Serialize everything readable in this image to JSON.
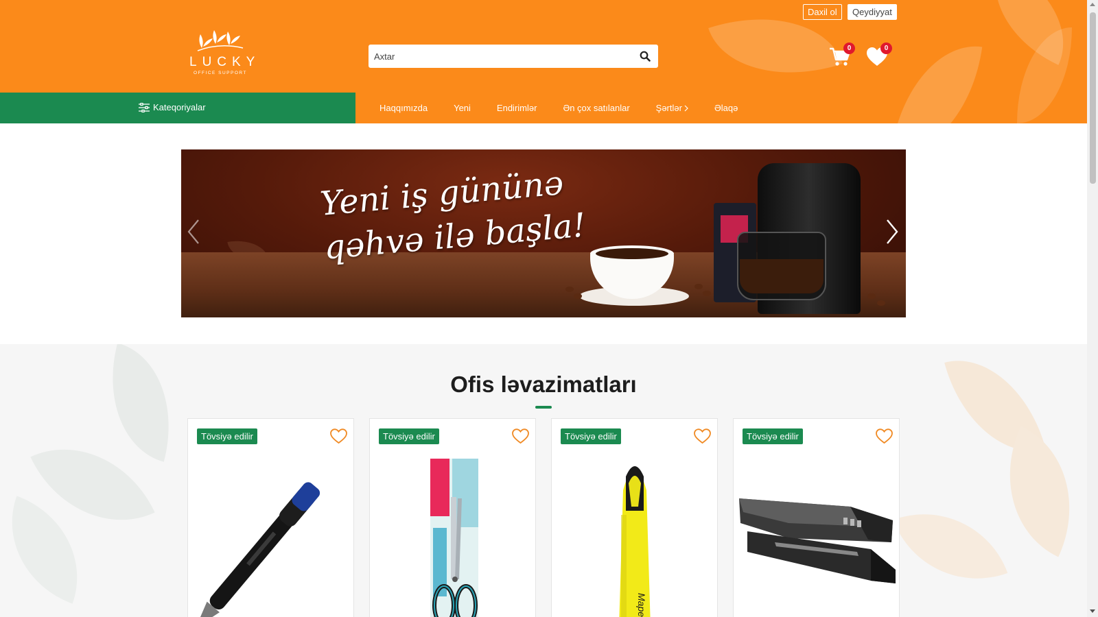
{
  "header": {
    "logo": {
      "name": "LUCKY",
      "subtitle": "OFFICE SUPPORT"
    },
    "search": {
      "placeholder": "Axtar",
      "value": ""
    },
    "auth": {
      "login_label": "Daxil ol",
      "register_label": "Qeydiyyat"
    },
    "cart": {
      "count": "0",
      "icon": "cart-icon"
    },
    "wishlist": {
      "count": "0",
      "icon": "heart-icon"
    },
    "colors": {
      "brand_orange": "#fb8a1a",
      "brand_green": "#1b8a50",
      "badge_red": "#e0182d"
    }
  },
  "nav": {
    "categories_label": "Kateqoriyalar",
    "items": [
      {
        "label": "Haqqımızda"
      },
      {
        "label": "Yeni"
      },
      {
        "label": "Endirimlər"
      },
      {
        "label": "Ən çox satılanlar"
      },
      {
        "label": "Şərtlər",
        "has_submenu": true
      },
      {
        "label": "Əlaqə"
      }
    ]
  },
  "banner": {
    "line1": "Yeni iş gününə",
    "line2": "qəhvə ilə başla!"
  },
  "section": {
    "title": "Ofis ləvazimatları",
    "products": [
      {
        "badge": "Tövsiyə edilir",
        "image": "pen"
      },
      {
        "badge": "Tövsiyə edilir",
        "image": "scissors"
      },
      {
        "badge": "Tövsiyə edilir",
        "image": "highlighter"
      },
      {
        "badge": "Tövsiyə edilir",
        "image": "stapler"
      }
    ]
  }
}
